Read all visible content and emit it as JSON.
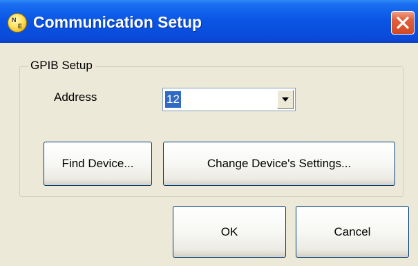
{
  "window": {
    "title": "Communication Setup",
    "icon": "app-logo-icon",
    "icon_letters": [
      "N",
      "E"
    ],
    "close_icon": "close-icon"
  },
  "group": {
    "label": "GPIB Setup",
    "address": {
      "label": "Address",
      "value": "12",
      "dropdown_icon": "chevron-down-icon"
    },
    "find_button": "Find Device...",
    "change_button": "Change Device's Settings..."
  },
  "footer": {
    "ok_button": "OK",
    "cancel_button": "Cancel"
  },
  "colors": {
    "titlebar": "#0a56e6",
    "close": "#d14a25",
    "selection": "#316ac5",
    "background": "#ece9d8"
  }
}
